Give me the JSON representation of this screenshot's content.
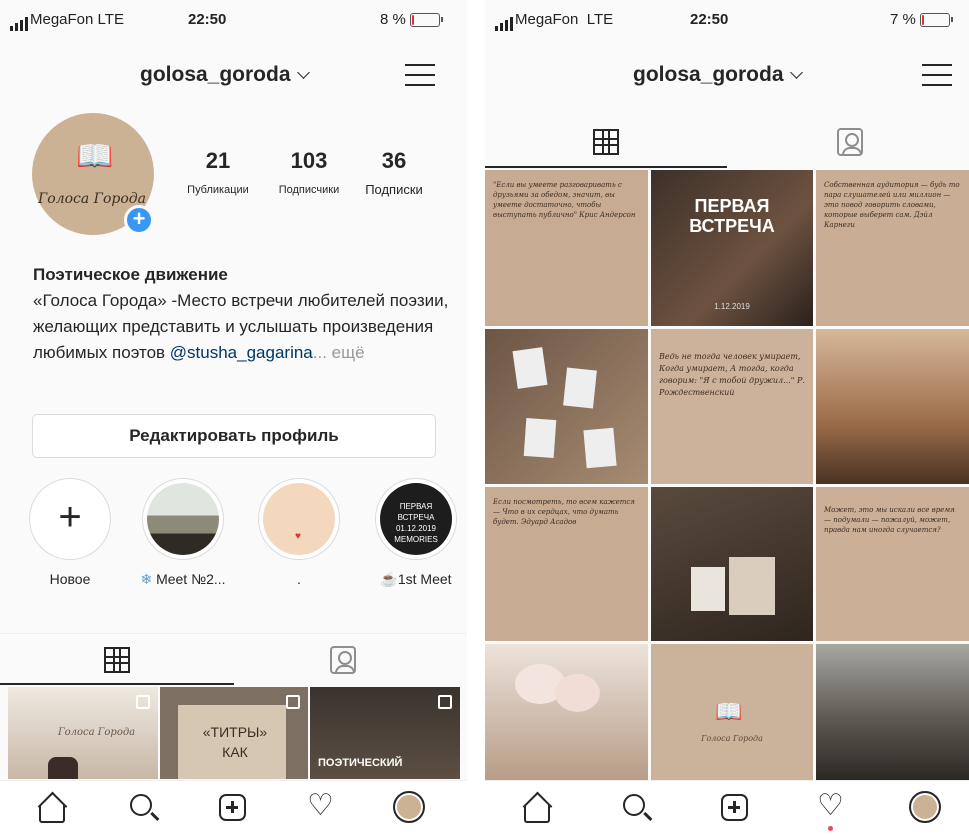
{
  "left": {
    "status": {
      "carrier": "MegaFon",
      "network": "LTE",
      "time": "22:50",
      "battery": "8 %",
      "battery_level": 0.08
    },
    "username": "golosa_goroda",
    "avatar": {
      "signature": "Голоса Города"
    },
    "stats": [
      {
        "count": "21",
        "label": "Публикации"
      },
      {
        "count": "103",
        "label": "Подписчики"
      },
      {
        "count": "36",
        "label": "Подписки"
      }
    ],
    "bio": {
      "name": "Поэтическое движение",
      "text": "«Голоса Города» -Место встречи любителей поэзии, желающих представить и услышать произведения любимых поэтов ",
      "mention": "@stusha_gagarina",
      "more": "... ещё"
    },
    "edit_profile_label": "Редактировать профиль",
    "highlights": [
      {
        "label": "Новое",
        "plus": "+"
      },
      {
        "label": "Meet №2..."
      },
      {
        "label": "."
      },
      {
        "label": "1st Meet",
        "overlay": "ПЕРВАЯ ВСТРЕЧА 01.12.2019 MEMORIES"
      }
    ],
    "grid_preview": [
      {
        "text": "Голоса Города"
      },
      {
        "text": "«ТИТРЫ» КАК"
      },
      {
        "text": "ПОЭТИЧЕСКИЙ"
      }
    ]
  },
  "right": {
    "status": {
      "carrier": "MegaFon",
      "network": "LTE",
      "time": "22:50",
      "battery": "7 %",
      "battery_level": 0.07
    },
    "username": "golosa_goroda",
    "tiles": [
      {
        "kind": "quote",
        "text": "\"Если вы умеете разговаривать с друзьями за обедом, значит, вы умеете достаточно, чтобы выступать публично\" Крис Андерсон"
      },
      {
        "kind": "photo",
        "title": "ПЕРВАЯ ВСТРЕЧА",
        "sub": "1.12.2019"
      },
      {
        "kind": "quote",
        "text": "Собственная аудитория — будь то пара слушателей или миллион — это повод говорить словами, которые выберет сам. Дэйл Карнеги"
      },
      {
        "kind": "photo"
      },
      {
        "kind": "quote",
        "text": "Ведь не тогда человек умирает, Когда умирает, А тогда, когда говорим: \"Я с тобой дружил...\" Р. Рождественский"
      },
      {
        "kind": "photo"
      },
      {
        "kind": "quote",
        "text": "Если посмотреть, то всем кажется — Что в их сердцах, что думать будет. Эдуард Асадов"
      },
      {
        "kind": "photo"
      },
      {
        "kind": "quote",
        "text": "Может, это мы искали все время — подумали — пожалуй, может, правда нам иногда случается? "
      },
      {
        "kind": "photo"
      },
      {
        "kind": "logo",
        "text": "Голоса Города"
      },
      {
        "kind": "photo"
      }
    ]
  },
  "colors": {
    "accent": "#3897f0",
    "beige": "#cbb295",
    "link": "#003569",
    "notify": "#ed4956"
  },
  "icons": [
    "grid-icon",
    "tagged-icon",
    "home-icon",
    "search-icon",
    "add-post-icon",
    "heart-icon",
    "menu-icon"
  ]
}
